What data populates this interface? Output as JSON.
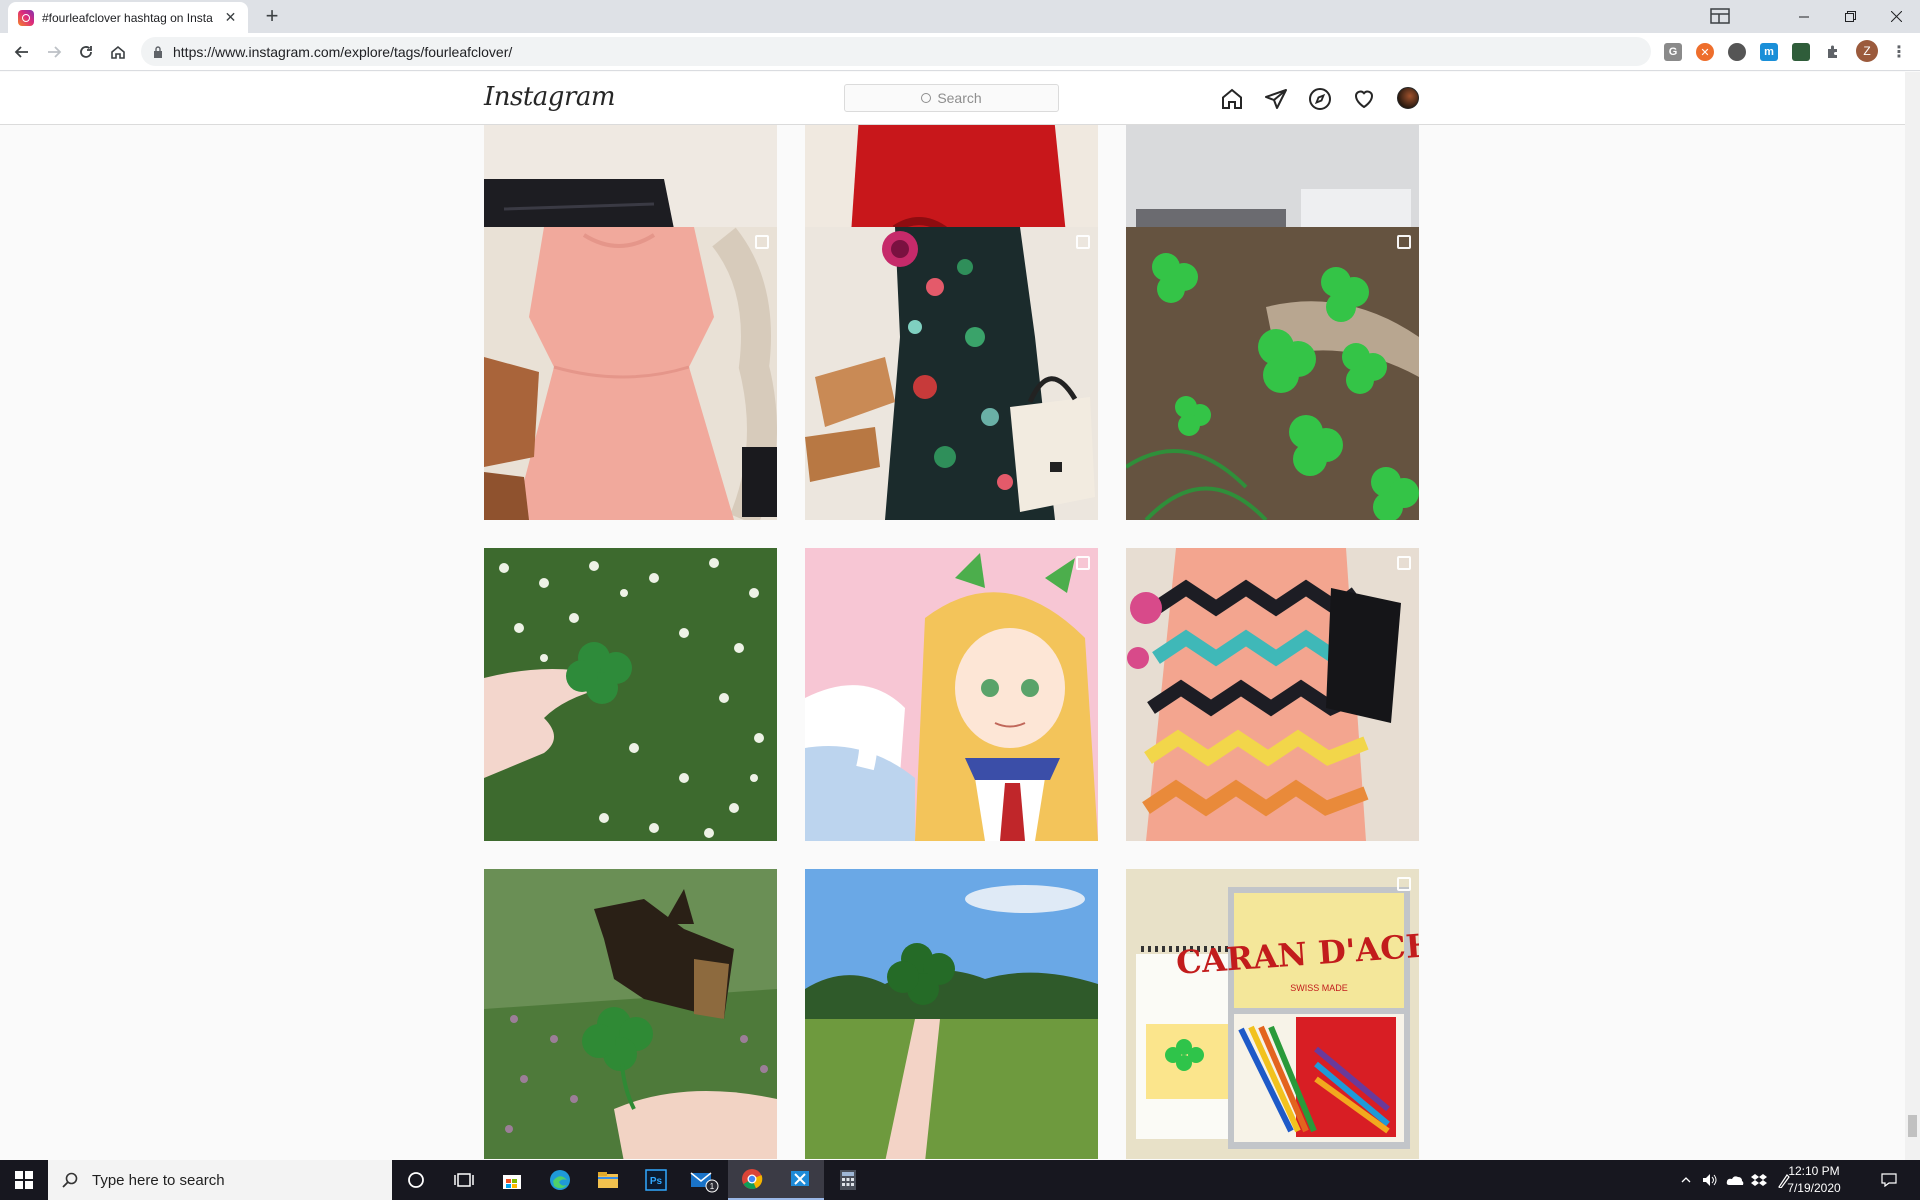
{
  "browser": {
    "tab_title": "#fourleafclover hashtag on Insta",
    "url": "https://www.instagram.com/explore/tags/fourleafclover/",
    "profile_initial": "Z"
  },
  "instagram": {
    "logo": "Instagram",
    "search_placeholder": "Search"
  },
  "taskbar": {
    "search_placeholder": "Type here to search",
    "time": "12:10 PM",
    "date": "7/19/2020",
    "mail_badge": "1"
  },
  "posts": [
    {
      "row": 0,
      "col": 0,
      "multi": false,
      "icon": "outfit-photo"
    },
    {
      "row": 0,
      "col": 1,
      "multi": false,
      "icon": "outfit-photo"
    },
    {
      "row": 0,
      "col": 2,
      "multi": false,
      "icon": "desk-photo"
    },
    {
      "row": 1,
      "col": 0,
      "multi": true,
      "icon": "pink-dress-photo"
    },
    {
      "row": 1,
      "col": 1,
      "multi": true,
      "icon": "floral-dress-photo"
    },
    {
      "row": 1,
      "col": 2,
      "multi": true,
      "icon": "clover-patch-photo"
    },
    {
      "row": 2,
      "col": 0,
      "multi": false,
      "icon": "hand-clover-photo"
    },
    {
      "row": 2,
      "col": 1,
      "multi": true,
      "icon": "anime-illustration"
    },
    {
      "row": 2,
      "col": 2,
      "multi": true,
      "icon": "zigzag-dress-photo"
    },
    {
      "row": 3,
      "col": 0,
      "multi": false,
      "icon": "dog-clover-photo"
    },
    {
      "row": 3,
      "col": 1,
      "multi": false,
      "icon": "field-clover-photo"
    },
    {
      "row": 3,
      "col": 2,
      "multi": true,
      "icon": "caran-dache-photo"
    }
  ],
  "caran_dache_text": "CARAN D'ACHE",
  "caran_dache_sub": "SWISS MADE",
  "colors": {
    "ig_text": "#262626",
    "border": "#dbdbdb",
    "background": "#fafafa",
    "clover_green": "#3cc44a"
  }
}
